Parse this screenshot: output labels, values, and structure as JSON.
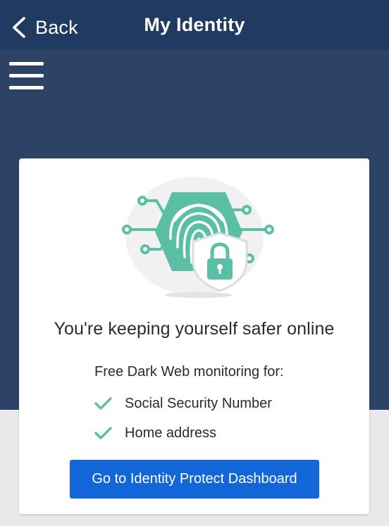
{
  "nav": {
    "back_label": "Back",
    "title": "My Identity"
  },
  "card": {
    "illustration_icon": "fingerprint-shield-lock-icon",
    "heading": "You're keeping yourself safer online",
    "intro": "Free Dark Web monitoring for:",
    "items": [
      {
        "label": "Social Security Number",
        "icon": "check-icon"
      },
      {
        "label": "Home address",
        "icon": "check-icon"
      }
    ],
    "cta_label": "Go to Identity Protect Dashboard"
  },
  "colors": {
    "nav_background": "#213a62",
    "hero_background": "#2d4366",
    "page_background": "#e9e9eb",
    "accent_teal": "#5bbfa5",
    "cta_blue": "#1266d8"
  }
}
